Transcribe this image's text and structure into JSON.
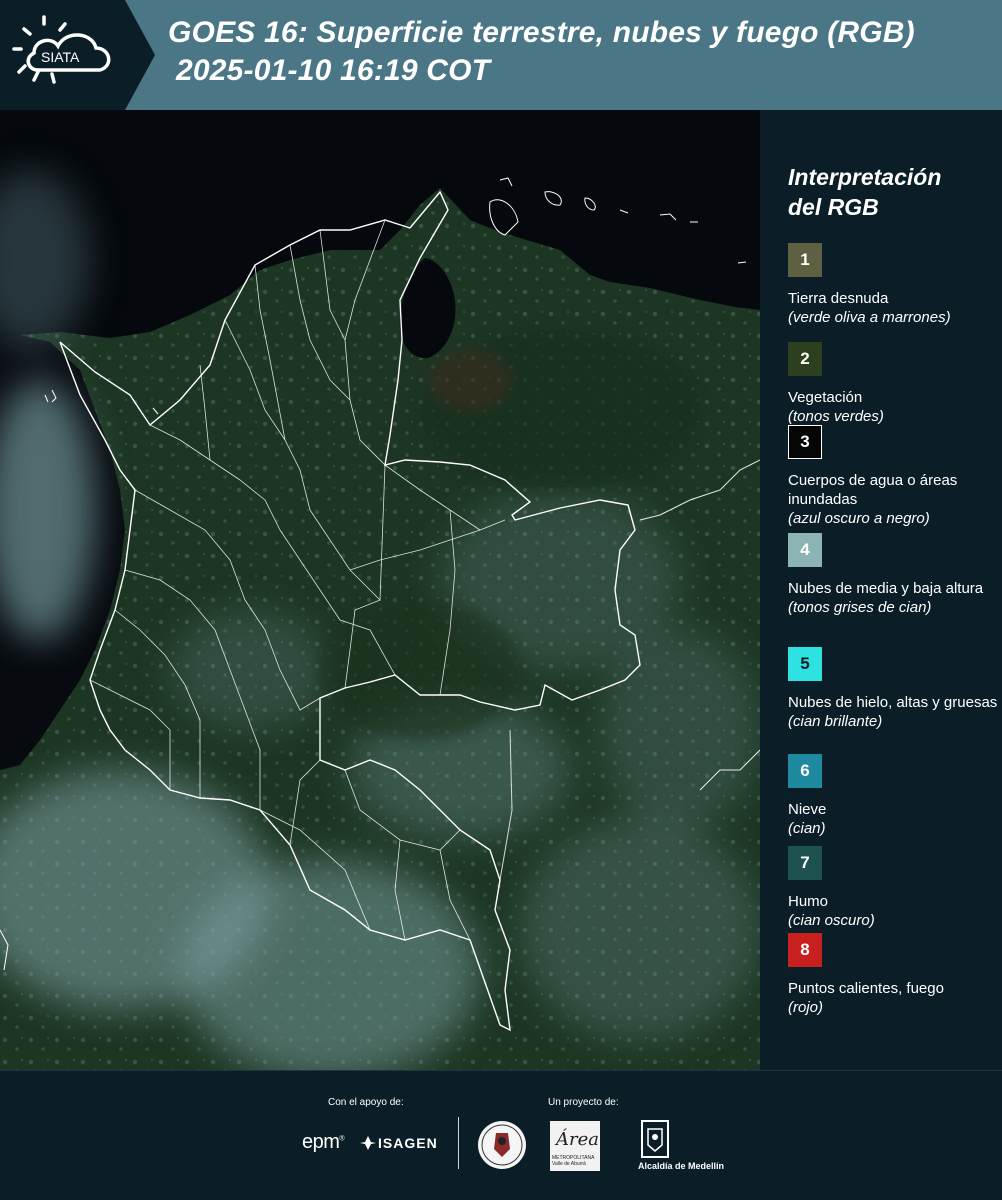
{
  "header": {
    "logo_text": "SIATA",
    "title_line1": "GOES 16: Superficie terrestre, nubes y fuego (RGB)",
    "title_line2": "2025-01-10 16:19 COT"
  },
  "legend": {
    "title_line1": "Interpretación",
    "title_line2": "del RGB",
    "items": [
      {
        "num": "1",
        "label": "Tierra desnuda",
        "desc": "(verde oliva a marrones)",
        "color": "#5f5f41",
        "text_color": "#ffffff"
      },
      {
        "num": "2",
        "label": "Vegetación",
        "desc": "(tonos verdes)",
        "color": "#2c3f1f",
        "text_color": "#ffffff"
      },
      {
        "num": "3",
        "label": "Cuerpos de agua o áreas inundadas",
        "desc": "(azul oscuro a negro)",
        "color": "#050505",
        "text_color": "#ffffff"
      },
      {
        "num": "4",
        "label": "Nubes de media y baja altura",
        "desc": "(tonos grises de cian)",
        "color": "#8db4b5",
        "text_color": "#ffffff"
      },
      {
        "num": "5",
        "label": "Nubes de hielo, altas y gruesas",
        "desc": "(cian brillante)",
        "color": "#2ee2e2",
        "text_color": "#0b1e28"
      },
      {
        "num": "6",
        "label": "Nieve",
        "desc": "(cian)",
        "color": "#1e8aa0",
        "text_color": "#ffffff"
      },
      {
        "num": "7",
        "label": "Humo",
        "desc": "(cian oscuro)",
        "color": "#1d5250",
        "text_color": "#ffffff"
      },
      {
        "num": "8",
        "label": "Puntos calientes, fuego",
        "desc": "(rojo)",
        "color": "#c8201e",
        "text_color": "#ffffff"
      }
    ]
  },
  "footer": {
    "support_label": "Con el apoyo de:",
    "project_label": "Un proyecto de:",
    "sponsor_epm": "epm",
    "sponsor_isagen": "ISAGEN",
    "area_logo_text": "Área",
    "area_logo_sub": "METROPOLITANA Valle de Aburrá",
    "alcaldia_label": "Alcaldía de Medellín"
  },
  "colors": {
    "header_bg": "#4a7686",
    "panel_bg": "#0b1e28",
    "land": "#203a26",
    "clouds": "#8fb3b6",
    "ocean": "#06080c"
  }
}
